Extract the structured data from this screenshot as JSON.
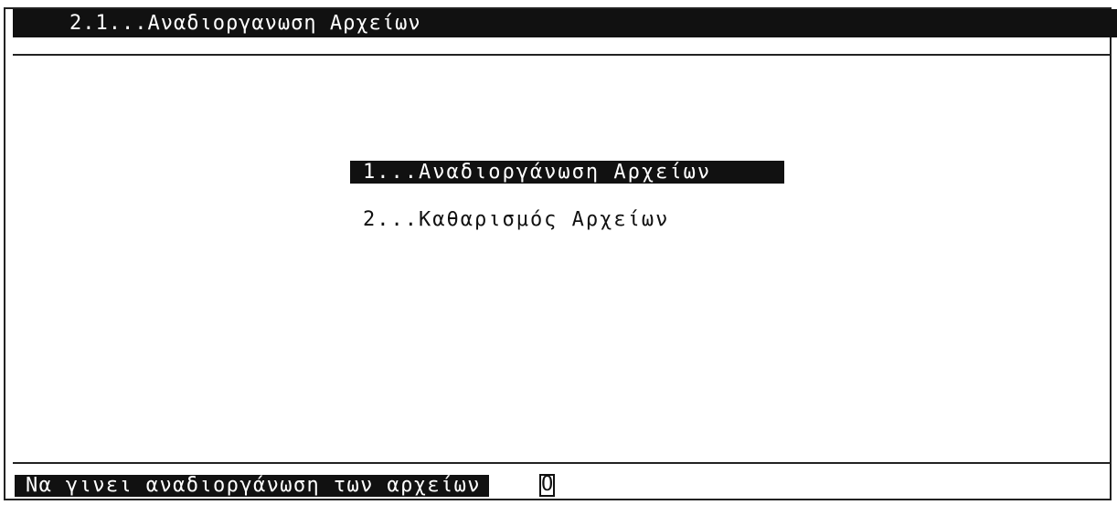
{
  "title": "2.1...Αναδιοργανωση Αρχείων",
  "menu": {
    "items": [
      {
        "label": "1...Αναδιοργάνωση  Αρχείων",
        "selected": true
      },
      {
        "label": "2...Καθαρισμός  Αρχείων",
        "selected": false
      }
    ]
  },
  "prompt": {
    "label": "Να γινει αναδιοργάνωση των αρχείων",
    "value": "O"
  }
}
